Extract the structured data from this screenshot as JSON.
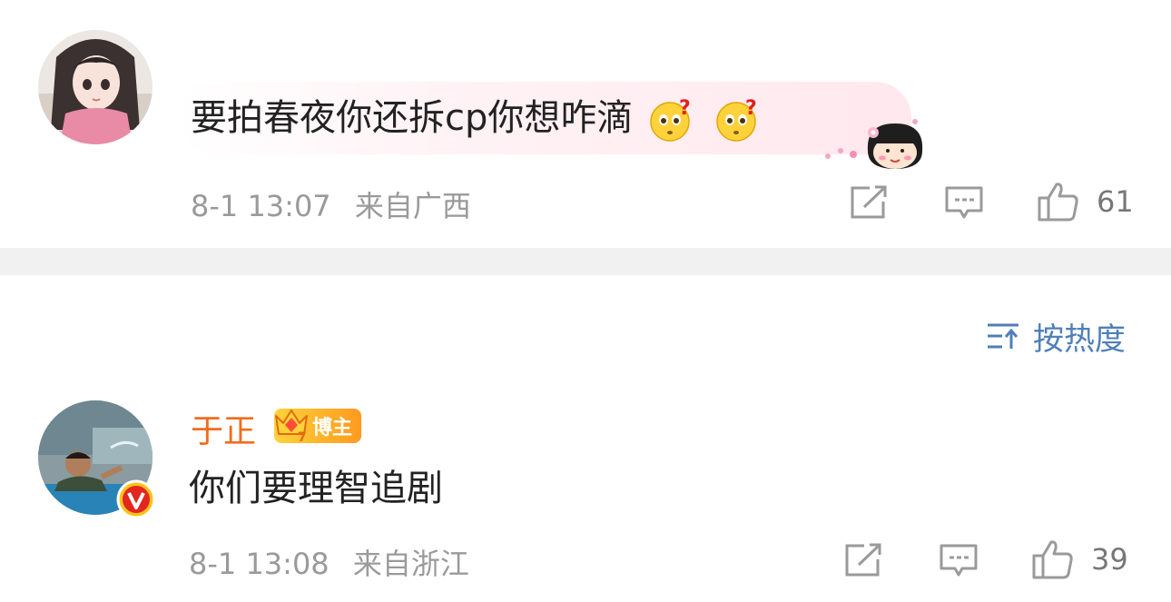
{
  "comments": [
    {
      "text": "要拍春夜你还拆cp你想咋滴",
      "emojis": [
        "confused-face-emoji",
        "confused-face-emoji"
      ],
      "time": "8-1 13:07",
      "location": "来自广西",
      "likes": "61"
    },
    {
      "username": "于正",
      "badge": "博主",
      "verified": true,
      "text": "你们要理智追剧",
      "time": "8-1 13:08",
      "location": "来自浙江",
      "likes": "39"
    }
  ],
  "sort": {
    "label": "按热度"
  },
  "colors": {
    "accent": "#4f7fb8",
    "username": "#f26b1d",
    "meta": "#9a9a9a"
  }
}
